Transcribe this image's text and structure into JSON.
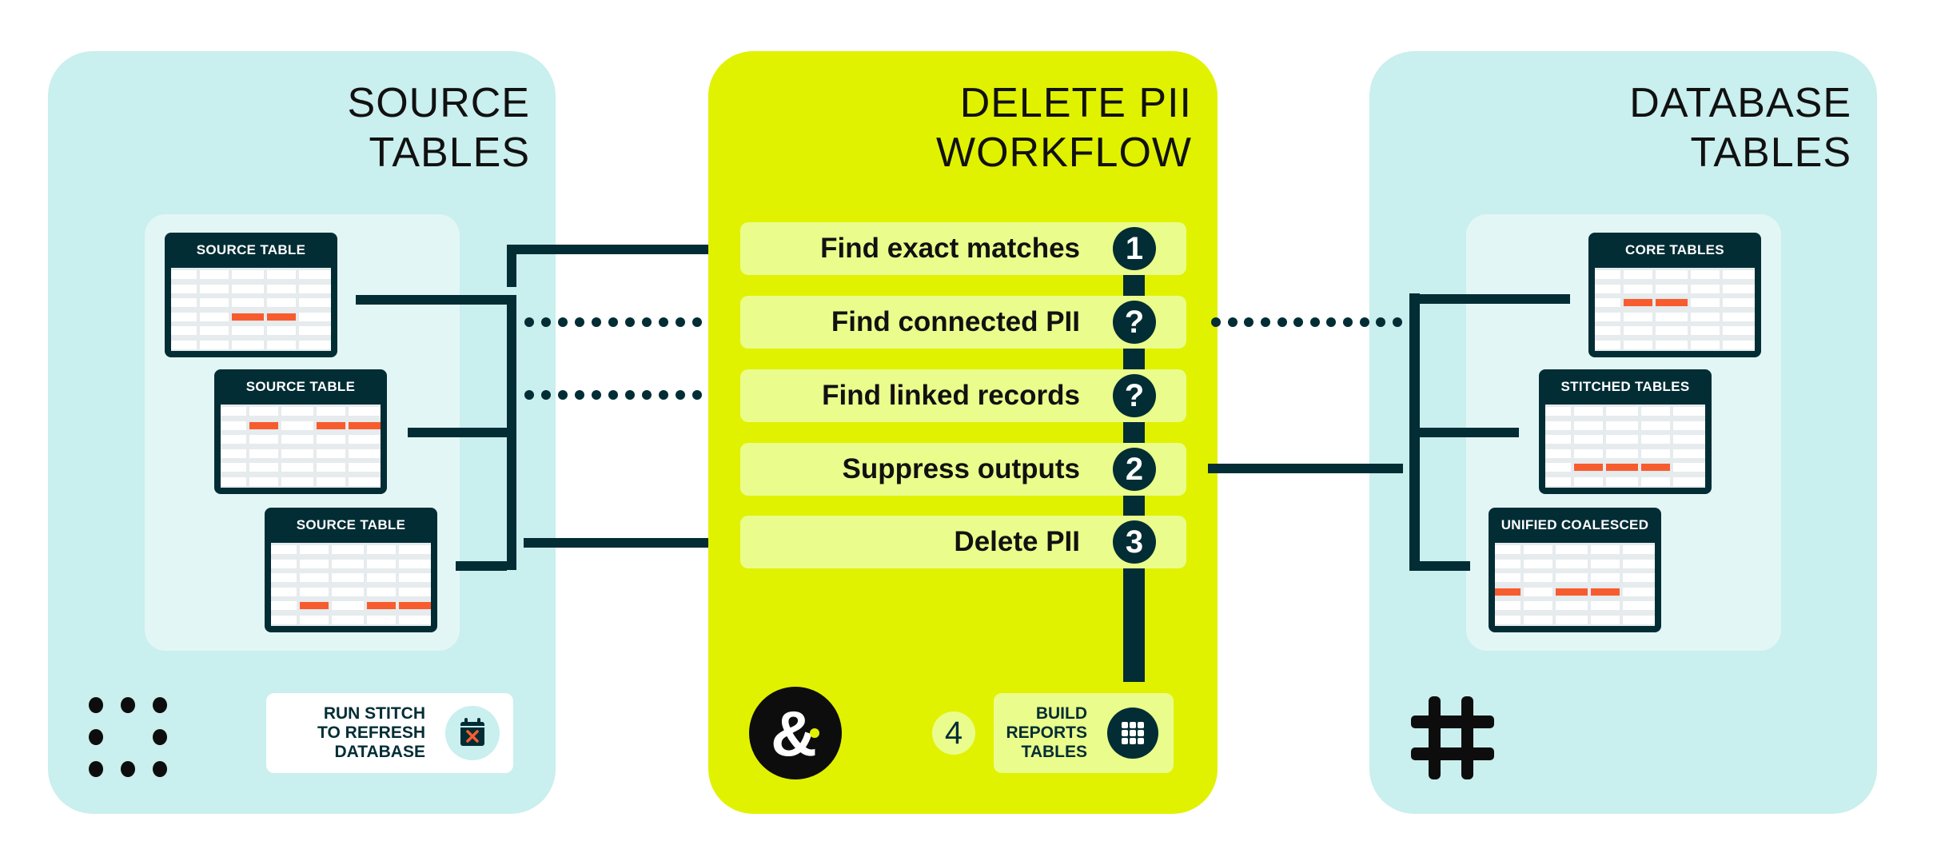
{
  "diagram": {
    "source_panel": {
      "title_lines": [
        "SOURCE",
        "TABLES"
      ],
      "tables": [
        {
          "label": "SOURCE TABLE",
          "highlights": [
            [
              3,
              2
            ],
            [
              3,
              3
            ]
          ]
        },
        {
          "label": "SOURCE TABLE",
          "highlights": [
            [
              1,
              1
            ],
            [
              1,
              3
            ],
            [
              1,
              4
            ]
          ]
        },
        {
          "label": "SOURCE TABLE",
          "highlights": [
            [
              4,
              1
            ],
            [
              4,
              3
            ],
            [
              4,
              4
            ]
          ]
        }
      ],
      "action_card": {
        "lines": [
          "RUN STITCH",
          "TO REFRESH",
          "DATABASE"
        ],
        "icon": "calendar-x-icon"
      },
      "corner_icon": "dots-ring-icon"
    },
    "workflow_panel": {
      "title_lines": [
        "DELETE PII",
        "WORKFLOW"
      ],
      "steps": [
        {
          "label": "Find exact matches",
          "badge": "1",
          "source_link": "solid",
          "database_link": "none"
        },
        {
          "label": "Find connected PII",
          "badge": "?",
          "source_link": "dotted",
          "database_link": "dotted"
        },
        {
          "label": "Find linked records",
          "badge": "?",
          "source_link": "dotted",
          "database_link": "none"
        },
        {
          "label": "Suppress outputs",
          "badge": "2",
          "source_link": "none",
          "database_link": "solid"
        },
        {
          "label": "Delete PII",
          "badge": "3",
          "source_link": "solid",
          "database_link": "none"
        }
      ],
      "final_step": {
        "number": "4",
        "lines": [
          "BUILD",
          "REPORTS",
          "TABLES"
        ],
        "icon": "grid-icon"
      },
      "logo": "ampersand-logo"
    },
    "database_panel": {
      "title_lines": [
        "DATABASE",
        "TABLES"
      ],
      "tables": [
        {
          "label": "CORE TABLES",
          "highlights": [
            [
              2,
              1
            ],
            [
              2,
              2
            ]
          ]
        },
        {
          "label": "STITCHED TABLES",
          "highlights": [
            [
              4,
              1
            ],
            [
              4,
              2
            ],
            [
              4,
              3
            ]
          ]
        },
        {
          "label": "UNIFIED COALESCED",
          "highlights": [
            [
              3,
              0
            ],
            [
              3,
              2
            ],
            [
              3,
              3
            ]
          ]
        }
      ],
      "corner_icon": "hash-icon"
    }
  },
  "colors": {
    "teal_panel": "#c9efee",
    "lime_panel": "#e0f200",
    "step_row": "#eafd8c",
    "dark": "#022d35",
    "highlight": "#f75c2f"
  }
}
